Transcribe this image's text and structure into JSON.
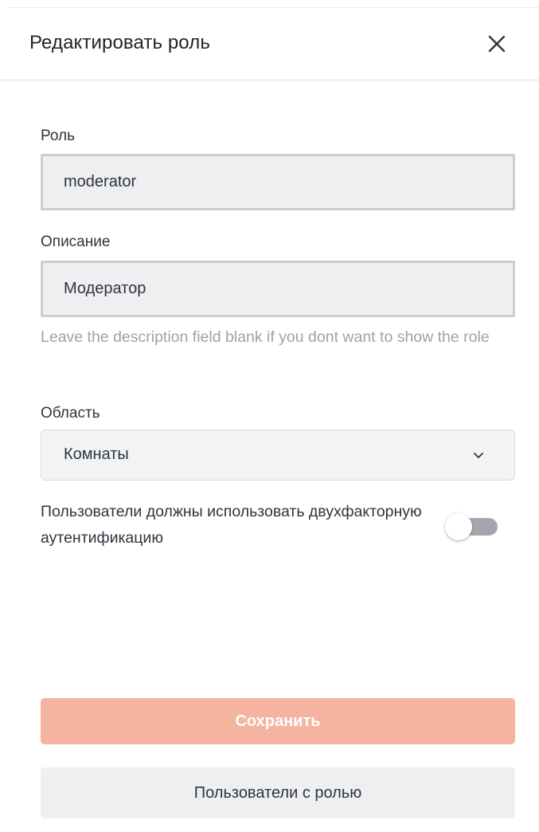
{
  "header": {
    "title": "Редактировать роль",
    "close_icon": "close-icon"
  },
  "form": {
    "role": {
      "label": "Роль",
      "value": "moderator"
    },
    "description": {
      "label": "Описание",
      "value": "Модератор",
      "hint": "Leave the description field blank if you dont want to show the role"
    },
    "scope": {
      "label": "Область",
      "selected": "Комнаты",
      "icon": "chevron-down-icon"
    },
    "two_factor": {
      "label": "Пользователи должны использовать двухфакторную аутентификацию",
      "enabled": false
    }
  },
  "actions": {
    "save_label": "Сохранить",
    "users_label": "Пользователи с ролью"
  },
  "colors": {
    "save_button_bg": "#f5b4a0",
    "toggle_off_track": "#a3a7ad",
    "input_bg": "#eeeff1",
    "hint_text": "#9ea2a8"
  }
}
